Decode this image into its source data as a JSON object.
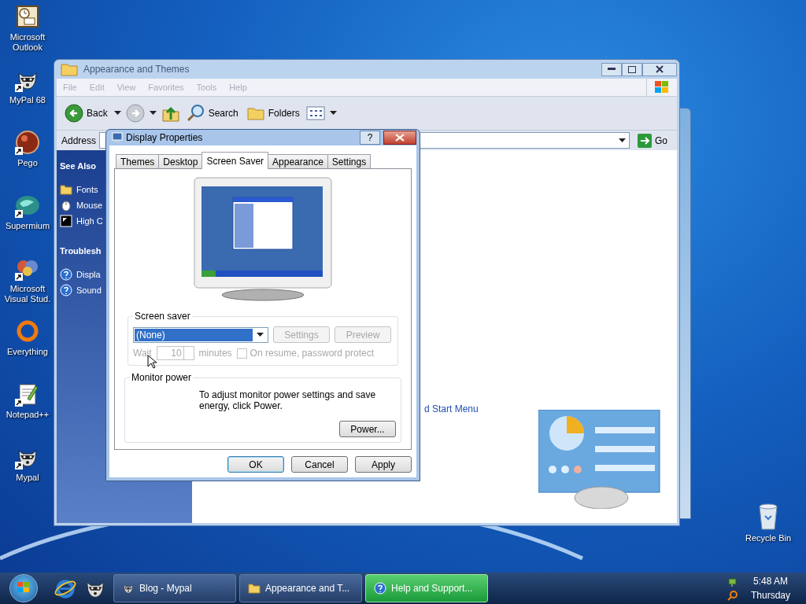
{
  "desktop_icons": [
    {
      "label": "Microsoft Outlook",
      "kind": "outlook",
      "shortcut": false
    },
    {
      "label": "MyPal 68",
      "kind": "raccoon",
      "shortcut": true
    },
    {
      "label": "Pego",
      "kind": "pego",
      "shortcut": true
    },
    {
      "label": "Supermium",
      "kind": "supermium",
      "shortcut": true
    },
    {
      "label": "Microsoft Visual Stud.",
      "kind": "vs",
      "shortcut": true
    },
    {
      "label": "Everything",
      "kind": "everything",
      "shortcut": false
    },
    {
      "label": "Notepad++",
      "kind": "notepad",
      "shortcut": true
    },
    {
      "label": "Mypal",
      "kind": "raccoon",
      "shortcut": true
    }
  ],
  "recycle_bin": {
    "label": "Recycle Bin"
  },
  "explorer": {
    "title": "Appearance and Themes",
    "active": false,
    "menu": [
      "File",
      "Edit",
      "View",
      "Favorites",
      "Tools",
      "Help"
    ],
    "toolbar": [
      {
        "kind": "back",
        "label": "Back"
      },
      {
        "kind": "forward"
      },
      {
        "kind": "up"
      },
      {
        "kind": "search",
        "label": "Search"
      },
      {
        "kind": "folders",
        "label": "Folders"
      },
      {
        "kind": "views"
      }
    ],
    "address_label": "Address",
    "go_label": "Go",
    "sidebar": [
      {
        "title": "See Also",
        "items": [
          {
            "kind": "folder",
            "label": "Fonts"
          },
          {
            "kind": "mouse",
            "label": "Mouse"
          },
          {
            "kind": "contrast",
            "label": "High C"
          }
        ]
      },
      {
        "title": "Troublesh",
        "items": [
          {
            "kind": "help",
            "label": "Displa"
          },
          {
            "kind": "help",
            "label": "Sound"
          }
        ]
      }
    ],
    "content_link": "d Start Menu"
  },
  "dialog": {
    "title": "Display Properties",
    "help_button": "?",
    "tabs": [
      {
        "label": "Themes",
        "selected": false
      },
      {
        "label": "Desktop",
        "selected": false
      },
      {
        "label": "Screen Saver",
        "selected": true
      },
      {
        "label": "Appearance",
        "selected": false
      },
      {
        "label": "Settings",
        "selected": false
      }
    ],
    "screen_saver": {
      "legend": "Screen saver",
      "value": "(None)",
      "buttons": [
        {
          "label": "Settings",
          "disabled": true
        },
        {
          "label": "Preview",
          "disabled": true
        }
      ],
      "wait_disabled": true,
      "wait_label": "Wait",
      "wait_value": "10",
      "minutes_label": "minutes",
      "password": {
        "label": "On resume, password protect",
        "checked": false,
        "disabled": true
      }
    },
    "monitor_power": {
      "legend": "Monitor power",
      "text": "To adjust monitor power settings and save energy, click Power.",
      "button": "Power..."
    },
    "buttons": [
      {
        "label": "OK",
        "default": true
      },
      {
        "label": "Cancel",
        "default": false
      },
      {
        "label": "Apply",
        "default": false
      }
    ]
  },
  "taskbar": {
    "quick_launch": [
      {
        "kind": "ie"
      },
      {
        "kind": "raccoon"
      }
    ],
    "tasks": [
      {
        "label": "Blog - Mypal",
        "kind": "raccoon",
        "selected": false
      },
      {
        "label": "Appearance and T...",
        "kind": "folder",
        "selected": false
      },
      {
        "label": "Help and Support...",
        "kind": "help",
        "selected": true
      }
    ],
    "clock": {
      "time": "5:48 AM",
      "day": "Thursday"
    }
  }
}
